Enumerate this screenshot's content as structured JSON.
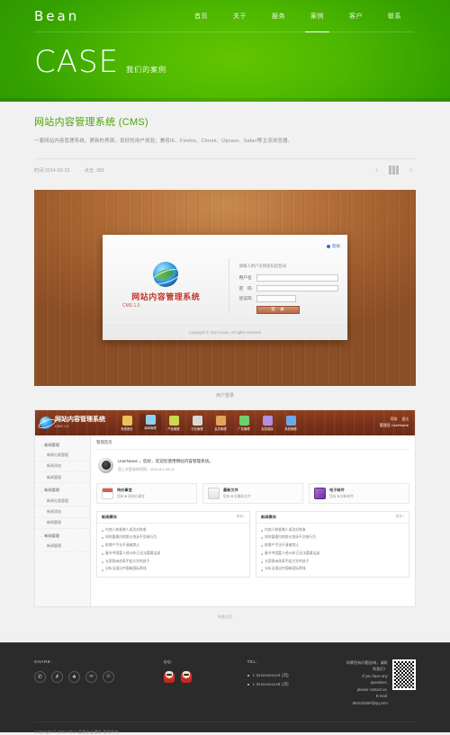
{
  "header": {
    "logo": "Bean",
    "nav": [
      {
        "label": "首页",
        "active": false
      },
      {
        "label": "关于",
        "active": false
      },
      {
        "label": "服务",
        "active": false
      },
      {
        "label": "案例",
        "active": true
      },
      {
        "label": "客户",
        "active": false
      },
      {
        "label": "联系",
        "active": false
      }
    ],
    "hero_title": "CASE",
    "hero_sub": "我们的案例"
  },
  "article": {
    "title": "网站内容管理系统 (CMS)",
    "desc": "一套网站内容管理系统，更新的界面，良好的用户体验；兼容IE、Firefox、Chrom、Oprase、Safari等主流浏览器。",
    "meta_date": "时间:2014-03-23",
    "meta_views": "点击: 381",
    "pager_prev": "‹",
    "pager_next": "›"
  },
  "shot1": {
    "caption": "用户登录",
    "help": "帮助",
    "cms_title": "网站内容管理系统",
    "cms_version": "CMS 1.0",
    "hint": "请输入用户名和密码后登录",
    "fields": [
      {
        "label": "用户名",
        "value": ""
      },
      {
        "label": "密　码",
        "value": ""
      },
      {
        "label": "验证码",
        "value": ""
      }
    ],
    "login_button": "登 录",
    "copyright": "Copyright © 2010 Kivoo. All rights reserved"
  },
  "shot2": {
    "caption": "系统主页",
    "brand_name": "网站内容管理系统",
    "brand_version": "CMS 1.0",
    "toolbar": [
      {
        "label": "系统首页",
        "color": "#e8c15a",
        "active": false
      },
      {
        "label": "新闻管理",
        "color": "#8fd0ef",
        "active": true
      },
      {
        "label": "产品管理",
        "color": "#c6da52",
        "active": false
      },
      {
        "label": "行业管理",
        "color": "#d8d8d8",
        "active": false
      },
      {
        "label": "会员管理",
        "color": "#e2a35c",
        "active": false
      },
      {
        "label": "广告管理",
        "color": "#6fcf6f",
        "active": false
      },
      {
        "label": "友情链接",
        "color": "#b38fe0",
        "active": false
      },
      {
        "label": "系统管理",
        "color": "#6aa9e9",
        "active": false
      }
    ],
    "pill_help": "帮助",
    "pill_logout": "退出",
    "user_label": "管理员 UserName",
    "breadcrumb": "管理首页",
    "welcome_line1": "UserName ，您好，欢迎您使用网站内容管理系统。",
    "welcome_line2": "您上次登录的时间：2011-8-3 09:12",
    "cards": [
      {
        "title": "待办事宜",
        "sub_pre": "您有 ",
        "count": "5",
        "sub_post": " 项待办事宜"
      },
      {
        "title": "最新文件",
        "sub_pre": "您有 ",
        "count": "5",
        "sub_post": " 份最新文件"
      },
      {
        "title": "电子邮件",
        "sub_pre": "您有 ",
        "count": "5",
        "sub_post": " 封新邮件"
      }
    ],
    "lists": [
      {
        "title": "新闻模块",
        "more": "更多>",
        "items": [
          "内地人和香港人成功对阵收",
          "如何整理内地房价泡沫不交纳行为",
          "前港产手法不清被禁止",
          "春节中国富人经50年已无法重要运送",
          "五家欧洲改革手起大学的孩子",
          "分析法语出中国新国际界线"
        ]
      },
      {
        "title": "新闻模块",
        "more": "更多>",
        "items": [
          "内地人和香港人成功对阵收",
          "如何整理内地房价泡沫不交纳行为",
          "前港产手法不清被禁止",
          "春节中国富人经50年已无法重要运送",
          "五家欧洲改革手起大学的孩子",
          "分析法语出中国新国际界线"
        ]
      }
    ],
    "sidebar": [
      {
        "head": "新闻管理",
        "links": [
          "新闻分类管理",
          "新闻添加",
          "新闻管理"
        ]
      },
      {
        "head": "新闻管理",
        "links": [
          "新闻分类管理",
          "新闻添加",
          "新闻管理"
        ]
      },
      {
        "head": "新闻管理",
        "links": [
          "新闻管理"
        ]
      }
    ]
  },
  "footer": {
    "share_head": "SHARE:",
    "share_icons": [
      "weibo-icon",
      "renren-icon",
      "star-icon",
      "douban-icon",
      "qzone-icon"
    ],
    "share_glyphs": [
      "✆",
      "✗",
      "★",
      "∞",
      "☺"
    ],
    "qq_head": "QQ:",
    "tel_head": "TEL:",
    "tels": [
      "1 3xxxxxxxxx4 (刘)",
      "1 3xxxxxxxxx9 (邓)"
    ],
    "contact_cn": "如果您有问题咨询，请联系我们！",
    "contact_en1": "If you have any questions,",
    "contact_en2": "please contact us.",
    "email": "E-mail: 66412526#@qq.com",
    "copyright": "Copyright © 2002-2013 某国企业模板 版权所有"
  }
}
